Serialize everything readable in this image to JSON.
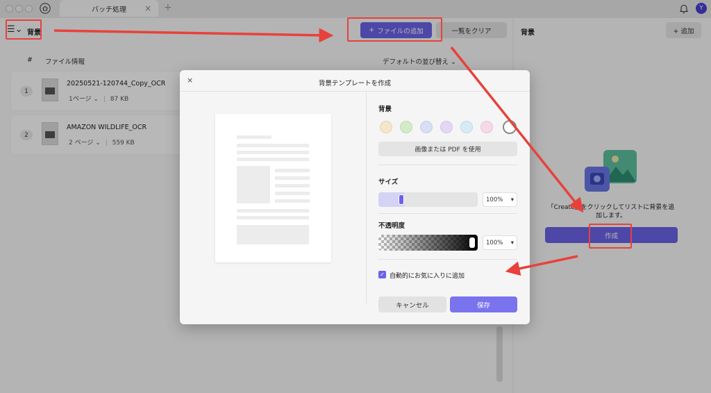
{
  "titlebar": {
    "tab_title": "バッチ処理",
    "tab_close": "×",
    "tab_plus": "+",
    "avatar_letter": "Y"
  },
  "toolbar": {
    "menu_glyph": "☰⌄",
    "mode_label": "背景",
    "add_file_label": "ファイルの追加",
    "add_file_glyph": "+",
    "clear_label": "一覧をクリア"
  },
  "file_list": {
    "col_index": "#",
    "col_info": "ファイル情報",
    "sort_label": "デフォルトの並び替え ⌄",
    "rows": [
      {
        "index": "1",
        "name": "20250521-120744_Copy_OCR",
        "pages": "1ページ ⌄",
        "size": "87 KB"
      },
      {
        "index": "2",
        "name": "AMAZON WILDLIFE_OCR",
        "pages": "2 ページ ⌄",
        "size": "559 KB"
      }
    ]
  },
  "right_panel": {
    "title": "背景",
    "add_label": "+ 追加",
    "hint": "「Create」をクリックしてリストに背景を追加します。",
    "create_label": "作成"
  },
  "modal": {
    "close_glyph": "×",
    "title": "背景テンプレートを作成",
    "background_label": "背景",
    "swatches": [
      "#f6e6c9",
      "#d2ecc5",
      "#d8dff4",
      "#e2d8f6",
      "#d6ebf6",
      "#f6d8e6"
    ],
    "use_image_label": "画像または PDF を使用",
    "size_label": "サイズ",
    "size_value": "100%",
    "size_level": 0.23,
    "opacity_label": "不透明度",
    "opacity_value": "100%",
    "opacity_level": 1.0,
    "caret": "▾",
    "auto_favorite_label": "自動的にお気に入りに追加",
    "auto_favorite_checked": true,
    "check_glyph": "✓",
    "cancel_label": "キャンセル",
    "save_label": "保存"
  },
  "colors": {
    "accent": "#6b63e8",
    "annotation": "#e8413b"
  }
}
